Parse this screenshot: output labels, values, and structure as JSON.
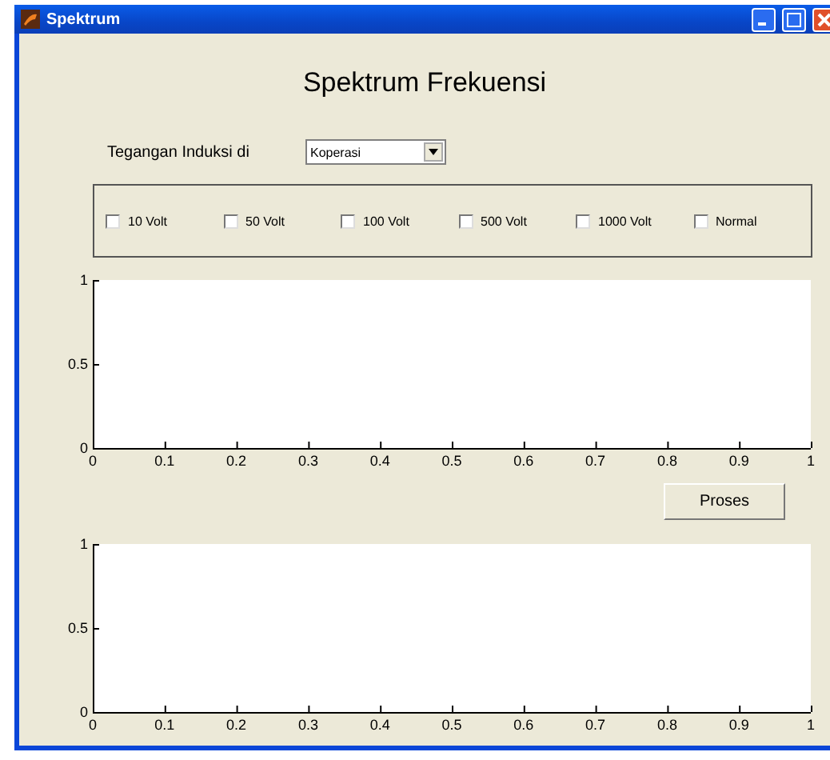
{
  "window": {
    "title": "Spektrum"
  },
  "heading": "Spektrum Frekuensi",
  "location": {
    "label": "Tegangan Induksi di",
    "value": "Koperasi"
  },
  "checkboxes": [
    {
      "label": "10 Volt",
      "checked": false
    },
    {
      "label": "50 Volt",
      "checked": false
    },
    {
      "label": "100 Volt",
      "checked": false
    },
    {
      "label": "500 Volt",
      "checked": false
    },
    {
      "label": "1000 Volt",
      "checked": false
    },
    {
      "label": "Normal",
      "checked": false
    }
  ],
  "charts": [
    {
      "chart_data": {
        "type": "line",
        "xlim": [
          0,
          1
        ],
        "ylim": [
          0,
          1
        ],
        "xticks": [
          0,
          0.1,
          0.2,
          0.3,
          0.4,
          0.5,
          0.6,
          0.7,
          0.8,
          0.9,
          1
        ],
        "yticks": [
          0,
          0.5,
          1
        ]
      }
    },
    {
      "chart_data": {
        "type": "line",
        "xlim": [
          0,
          1
        ],
        "ylim": [
          0,
          1
        ],
        "xticks": [
          0,
          0.1,
          0.2,
          0.3,
          0.4,
          0.5,
          0.6,
          0.7,
          0.8,
          0.9,
          1
        ],
        "yticks": [
          0,
          0.5,
          1
        ]
      }
    }
  ],
  "button": "Proses"
}
